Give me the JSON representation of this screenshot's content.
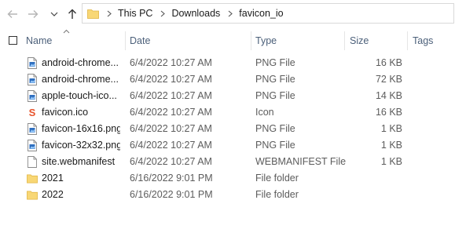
{
  "nav": {
    "back_icon": "arrow-left-icon",
    "forward_icon": "arrow-right-icon",
    "recent_icon": "chevron-down-icon",
    "up_icon": "arrow-up-icon"
  },
  "address": {
    "folder_icon": "folder-icon",
    "breadcrumbs": [
      "This PC",
      "Downloads",
      "favicon_io"
    ]
  },
  "columns": {
    "name": "Name",
    "date": "Date",
    "type": "Type",
    "size": "Size",
    "tags": "Tags"
  },
  "files": [
    {
      "name": "android-chrome...",
      "date": "6/4/2022 10:27 AM",
      "type": "PNG File",
      "size": "16 KB",
      "icon": "png-file-icon"
    },
    {
      "name": "android-chrome...",
      "date": "6/4/2022 10:27 AM",
      "type": "PNG File",
      "size": "72 KB",
      "icon": "png-file-icon"
    },
    {
      "name": "apple-touch-ico...",
      "date": "6/4/2022 10:27 AM",
      "type": "PNG File",
      "size": "14 KB",
      "icon": "png-file-icon"
    },
    {
      "name": "favicon.ico",
      "date": "6/4/2022 10:27 AM",
      "type": "Icon",
      "size": "16 KB",
      "icon": "favicon-icon"
    },
    {
      "name": "favicon-16x16.png",
      "date": "6/4/2022 10:27 AM",
      "type": "PNG File",
      "size": "1 KB",
      "icon": "png-file-icon"
    },
    {
      "name": "favicon-32x32.png",
      "date": "6/4/2022 10:27 AM",
      "type": "PNG File",
      "size": "1 KB",
      "icon": "png-file-icon"
    },
    {
      "name": "site.webmanifest",
      "date": "6/4/2022 10:27 AM",
      "type": "WEBMANIFEST File",
      "size": "1 KB",
      "icon": "blank-file-icon"
    },
    {
      "name": "2021",
      "date": "6/16/2022 9:01 PM",
      "type": "File folder",
      "size": "",
      "icon": "folder-icon"
    },
    {
      "name": "2022",
      "date": "6/16/2022 9:01 PM",
      "type": "File folder",
      "size": "",
      "icon": "folder-icon"
    }
  ],
  "colors": {
    "folder": "#f8d775",
    "folder_dark": "#e0b441",
    "header_text": "#4c607a",
    "favicon_accent": "#e8532b"
  }
}
